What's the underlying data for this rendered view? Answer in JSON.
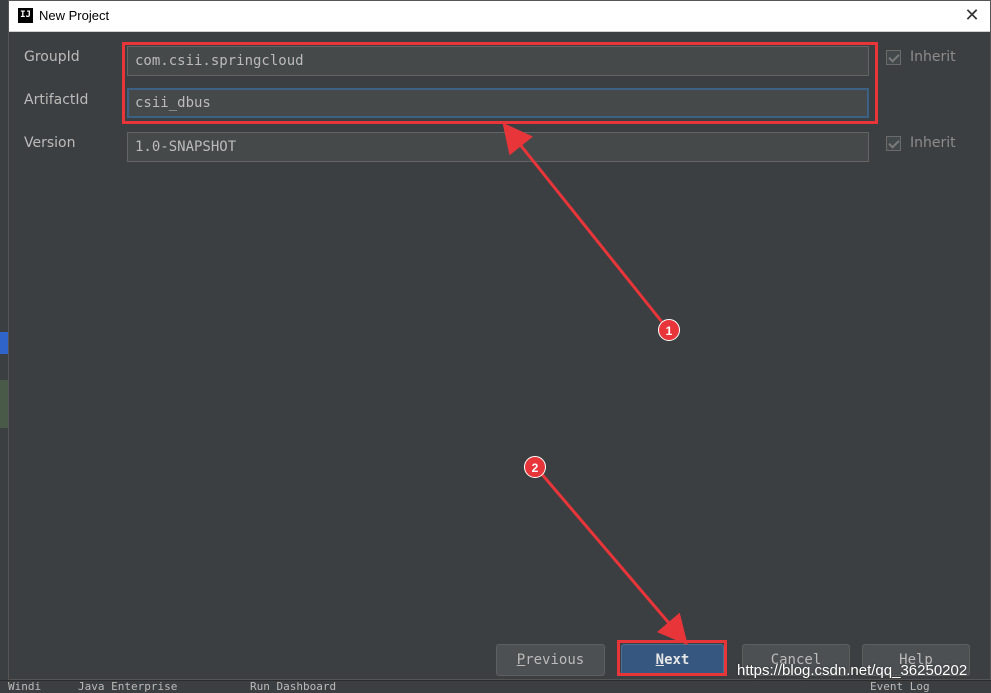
{
  "window": {
    "icon_text": "IJ",
    "title": "New Project",
    "close_glyph": "✕"
  },
  "form": {
    "group_id": {
      "label": "GroupId",
      "value": "com.csii.springcloud",
      "inherit_label": "Inherit",
      "inherit_checked": true
    },
    "artifact_id": {
      "label": "ArtifactId",
      "value": "csii_dbus"
    },
    "version": {
      "label": "Version",
      "value": "1.0-SNAPSHOT",
      "inherit_label": "Inherit",
      "inherit_checked": true
    }
  },
  "buttons": {
    "previous": {
      "mnemonic": "P",
      "rest": "revious"
    },
    "next": {
      "mnemonic": "N",
      "rest": "ext"
    },
    "cancel": "Cancel",
    "help": "Help"
  },
  "annotations": {
    "badge_1": "1",
    "badge_2": "2",
    "color": "#e8353a"
  },
  "background_ide": {
    "bottom_tabs": [
      "Windi",
      "Java Enterprise",
      "Run Dashboard",
      "Event Log"
    ]
  },
  "watermark": "https://blog.csdn.net/qq_36250202",
  "icons": {
    "close": "close-icon",
    "app": "intellij-icon",
    "check": "checkmark-icon"
  },
  "colors": {
    "panel": "#3c3f41",
    "field": "#45494a",
    "default_button": "#365880",
    "text": "#bbbbbb"
  }
}
